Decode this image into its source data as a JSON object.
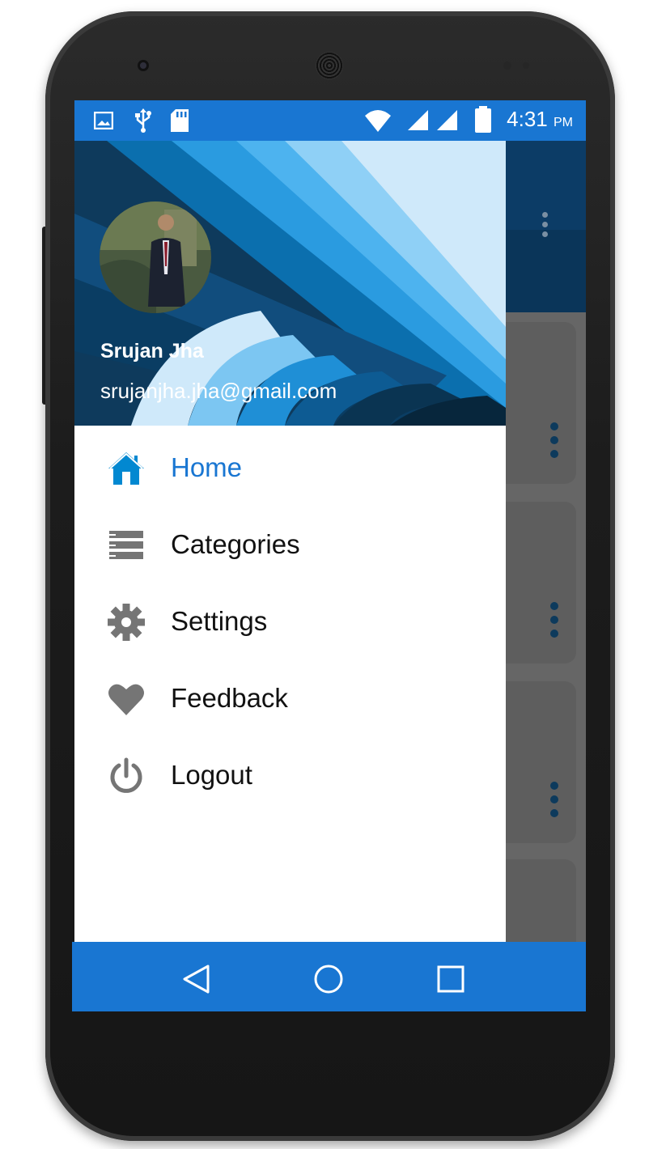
{
  "status_bar": {
    "left_icons": [
      "image-icon",
      "usb-icon",
      "sd-card-icon"
    ],
    "right_icons": [
      "wifi-icon",
      "signal-icon",
      "signal-icon",
      "battery-icon"
    ],
    "time": "4:31",
    "ampm": "PM"
  },
  "drawer": {
    "user_name": "Srujan Jha",
    "user_email": "srujanjha.jha@gmail.com",
    "items": [
      {
        "label": "Home",
        "icon": "home-icon",
        "active": true
      },
      {
        "label": "Categories",
        "icon": "list-icon",
        "active": false
      },
      {
        "label": "Settings",
        "icon": "gear-icon",
        "active": false
      },
      {
        "label": "Feedback",
        "icon": "heart-icon",
        "active": false
      },
      {
        "label": "Logout",
        "icon": "power-icon",
        "active": false
      }
    ]
  },
  "nav_bar": {
    "buttons": [
      "back-icon",
      "home-circle-icon",
      "recents-icon"
    ]
  },
  "colors": {
    "accent": "#1976d2",
    "icon_gray": "#757575",
    "home_icon": "#0288d1",
    "scrim": "#666666"
  }
}
